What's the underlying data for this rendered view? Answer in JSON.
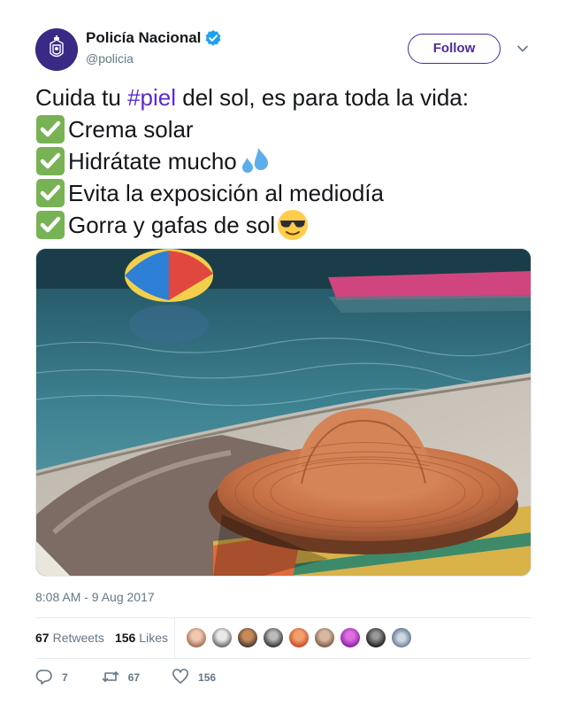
{
  "author": {
    "display_name": "Policía Nacional",
    "handle": "@policia",
    "verified": true
  },
  "follow_button": {
    "label": "Follow"
  },
  "tweet": {
    "intro_before": "Cuida tu ",
    "hashtag": "#piel",
    "intro_after": " del sol, es para toda la vida:",
    "items": [
      {
        "text": "Crema solar",
        "trailing_emoji": ""
      },
      {
        "text": "Hidrátate mucho",
        "trailing_emoji": "sweat-droplets-icon"
      },
      {
        "text": "Evita la exposición al mediodía",
        "trailing_emoji": ""
      },
      {
        "text": "Gorra y gafas de sol",
        "trailing_emoji": "sunglasses-face-icon"
      }
    ]
  },
  "timestamp": "8:08 AM - 9 Aug 2017",
  "stats": {
    "retweets_count": "67",
    "retweets_label": "Retweets",
    "likes_count": "156",
    "likes_label": "Likes"
  },
  "actions": {
    "replies": "7",
    "retweets": "67",
    "likes": "156"
  },
  "colors": {
    "accent": "#4a2a9e",
    "hashtag": "#5b2bd0",
    "secondary_text": "#657786",
    "verified": "#1da1f2"
  }
}
